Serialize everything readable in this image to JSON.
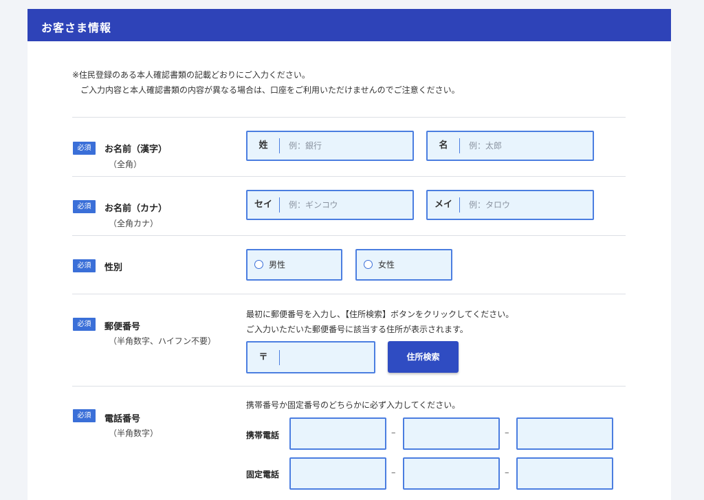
{
  "header": {
    "title": "お客さま情報"
  },
  "notice": {
    "line1": "※住民登録のある本人確認書類の記載どおりにご入力ください。",
    "line2": "ご入力内容と本人確認書類の内容が異なる場合は、口座をご利用いただけませんのでご注意ください。"
  },
  "required_badge": "必須",
  "name_kanji": {
    "label": "お名前（漢字）",
    "sublabel": "（全角）",
    "last": {
      "prefix": "姓",
      "placeholder": "例：銀行"
    },
    "first": {
      "prefix": "名",
      "placeholder": "例：太郎"
    }
  },
  "name_kana": {
    "label": "お名前（カナ）",
    "sublabel": "（全角カナ）",
    "last": {
      "prefix": "セイ",
      "placeholder": "例：ギンコウ"
    },
    "first": {
      "prefix": "メイ",
      "placeholder": "例：タロウ"
    }
  },
  "gender": {
    "label": "性別",
    "options": [
      "男性",
      "女性"
    ]
  },
  "postal": {
    "label": "郵便番号",
    "sublabel": "（半角数字、ハイフン不要）",
    "instruction1": "最初に郵便番号を入力し、【住所検索】ボタンをクリックしてください。",
    "instruction2": "ご入力いただいた郵便番号に該当する住所が表示されます。",
    "prefix": "〒",
    "button": "住所検索"
  },
  "phone": {
    "label": "電話番号",
    "sublabel": "（半角数字）",
    "instruction": "携帯番号か固定番号のどちらかに必ず入力してください。",
    "mobile_label": "携帯電話",
    "landline_label": "固定電話",
    "separator": "–"
  },
  "colors": {
    "header_bg": "#2e43b8",
    "field_border": "#4a7de0",
    "field_bg": "#e8f4fd",
    "required_bg": "#3a6fd8",
    "button_bg": "#2f4cc2"
  }
}
